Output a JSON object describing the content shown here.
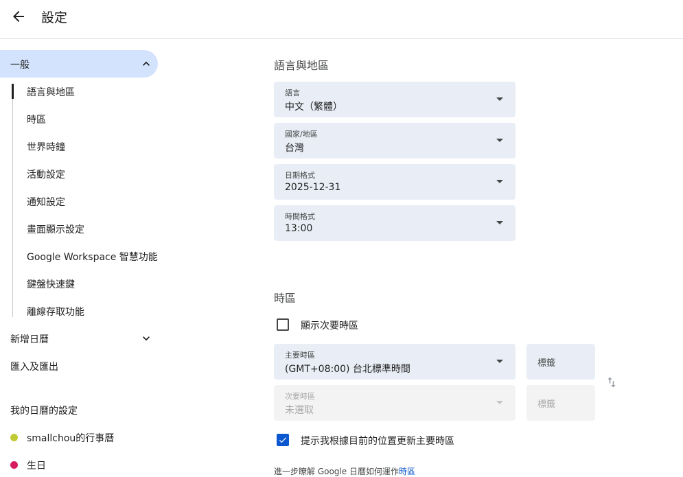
{
  "header": {
    "title": "設定",
    "back_icon": "arrow-back-icon"
  },
  "sidebar": {
    "general": "一般",
    "sub_items": [
      "語言與地區",
      "時區",
      "世界時鐘",
      "活動設定",
      "通知設定",
      "畫面顯示設定",
      "Google Workspace 智慧功能",
      "鍵盤快速鍵",
      "離線存取功能"
    ],
    "add_calendar": "新增日曆",
    "import_export": "匯入及匯出",
    "my_calendars_heading": "我的日曆的設定",
    "calendars": [
      {
        "name": "smallchou的行事曆",
        "color": "#c0ca33"
      },
      {
        "name": "生日",
        "color": "#d81b60"
      }
    ]
  },
  "language_region": {
    "title": "語言與地區",
    "fields": [
      {
        "label": "語言",
        "value": "中文（繁體）"
      },
      {
        "label": "國家/地區",
        "value": "台灣"
      },
      {
        "label": "日期格式",
        "value": "2025-12-31"
      },
      {
        "label": "時間格式",
        "value": "13:00"
      }
    ]
  },
  "timezone": {
    "title": "時區",
    "show_secondary_label": "顯示次要時區",
    "show_secondary_checked": false,
    "primary": {
      "label": "主要時區",
      "value": "(GMT+08:00) 台北標準時間",
      "tag": "標籤"
    },
    "secondary": {
      "label": "次要時區",
      "value": "未選取",
      "tag": "標籤"
    },
    "update_label": "提示我根據目前的位置更新主要時區",
    "update_checked": true,
    "learn_more_text": "進一步瞭解 Google 日曆如何運作",
    "learn_more_link": "時區"
  },
  "colors": {
    "accent": "#0b57d0",
    "nav_active": "#d3e3fd",
    "field_bg": "#e9eef6"
  }
}
